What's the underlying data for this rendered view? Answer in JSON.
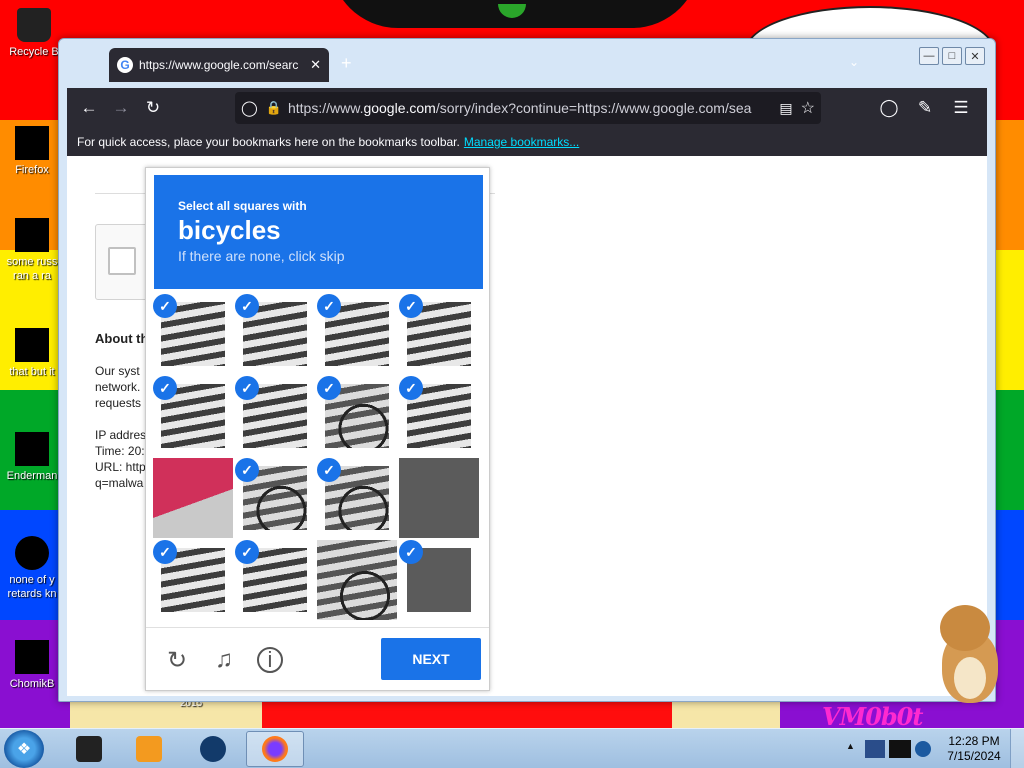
{
  "desktop": {
    "watermark": "VM0b0t",
    "icons": [
      {
        "label": "Recycle B"
      },
      {
        "label": "Firefox"
      },
      {
        "label": "some russ ran a ra"
      },
      {
        "label": "that but it"
      },
      {
        "label": "Enderman"
      },
      {
        "label": "none of y retards kn"
      },
      {
        "label": "ChomikB"
      }
    ],
    "shortcut_label": "2015"
  },
  "browser": {
    "tab": {
      "title": "https://www.google.com/searc",
      "close": "✕",
      "favicon": "G"
    },
    "new_tab": "+",
    "url_prefix": "https://www.",
    "url_domain": "google.com",
    "url_rest": "/sorry/index?continue=https://www.google.com/sea",
    "bookmarks_text": "For quick access, place your bookmarks here on the bookmarks toolbar.",
    "manage_bookmarks": "Manage bookmarks..."
  },
  "page": {
    "about_heading": "About th",
    "body_lines": "Our syst\nnetwork.\nrequests\n\nIP addres\nTime: 20:\nURL: http\nq=malwa"
  },
  "captcha": {
    "instruction_small": "Select all squares with",
    "target": "bicycles",
    "hint": "If there are none, click skip",
    "next_label": "NEXT",
    "checkmark": "✓",
    "selected": [
      true,
      true,
      true,
      true,
      true,
      true,
      true,
      true,
      false,
      true,
      true,
      false,
      true,
      true,
      false,
      true
    ]
  },
  "taskbar": {
    "time": "12:28 PM",
    "date": "7/15/2024"
  },
  "colors": {
    "captcha_blue": "#1a73e8",
    "firefox_dark": "#2b2a33"
  }
}
